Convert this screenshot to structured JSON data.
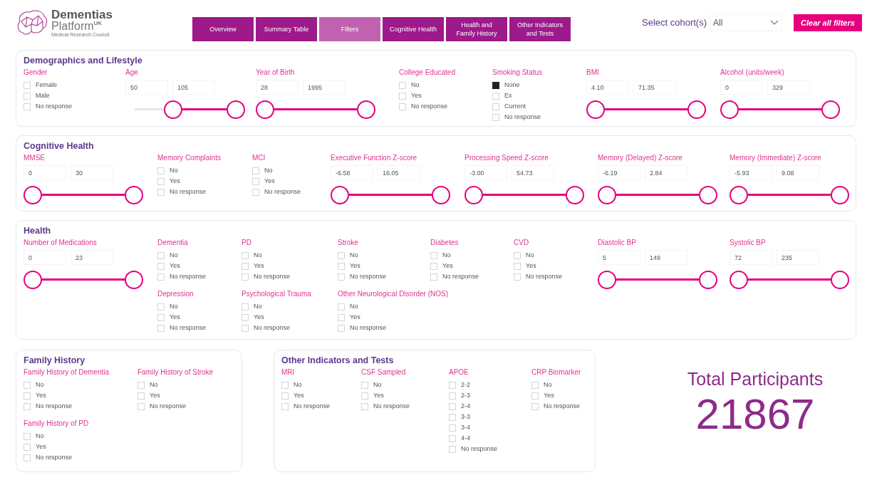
{
  "logo": {
    "name": "Dementias",
    "line2": "Platform",
    "superscript": "UK",
    "subtitle": "Medical Research Council"
  },
  "tabs": [
    {
      "label": "Overview",
      "selected": false
    },
    {
      "label": "Summary Table",
      "selected": false
    },
    {
      "label": "Filters",
      "selected": true
    },
    {
      "label": "Cognitive Health",
      "selected": false
    },
    {
      "label": "Health and Family History",
      "selected": false
    },
    {
      "label": "Other Indicators and Tests",
      "selected": false
    }
  ],
  "cohort": {
    "label": "Select cohort(s)",
    "value": "All"
  },
  "clear_button": "Clear all filters",
  "panels": [
    {
      "title": "Demographics and Lifestyle",
      "filters": [
        {
          "kind": "checklist",
          "label": "Gender",
          "options": [
            {
              "label": "Female",
              "checked": false
            },
            {
              "label": "Male",
              "checked": false
            },
            {
              "label": "No response",
              "checked": false
            }
          ]
        },
        {
          "kind": "range",
          "label": "Age",
          "min": "50",
          "max": "105",
          "level": 0.62
        },
        {
          "kind": "range",
          "label": "Year of Birth",
          "min": "28",
          "max": "1995",
          "level": 1
        },
        {
          "kind": "checklist",
          "label": "College Educated",
          "options": [
            {
              "label": "No",
              "checked": false
            },
            {
              "label": "Yes",
              "checked": false
            },
            {
              "label": "No response",
              "checked": false
            }
          ]
        },
        {
          "kind": "checklist",
          "label": "Smoking Status",
          "options": [
            {
              "label": "None",
              "checked": true
            },
            {
              "label": "Ex",
              "checked": false
            },
            {
              "label": "Current",
              "checked": false
            },
            {
              "label": "No response",
              "checked": false
            }
          ]
        },
        {
          "kind": "range",
          "label": "BMI",
          "min": "4.10",
          "max": "71.35",
          "level": 1
        },
        {
          "kind": "range",
          "label": "Alcohol (units/week)",
          "min": "0",
          "max": "329",
          "level": 1
        }
      ]
    },
    {
      "title": "Cognitive Health",
      "filters": [
        {
          "kind": "range",
          "label": "MMSE",
          "min": "0",
          "max": "30",
          "level": 1
        },
        {
          "kind": "checklist",
          "label": "Memory Complaints",
          "options": [
            {
              "label": "No",
              "checked": false
            },
            {
              "label": "Yes",
              "checked": false
            },
            {
              "label": "No response",
              "checked": false
            }
          ]
        },
        {
          "kind": "checklist",
          "label": "MCI",
          "options": [
            {
              "label": "No",
              "checked": false
            },
            {
              "label": "Yes",
              "checked": false
            },
            {
              "label": "No response",
              "checked": false
            }
          ]
        },
        {
          "kind": "range",
          "label": "Executive Function Z-score",
          "min": "-6.58",
          "max": "16.05",
          "level": 1
        },
        {
          "kind": "range",
          "label": "Processing Speed Z-score",
          "min": "-3.00",
          "max": "54.73",
          "level": 1
        },
        {
          "kind": "range",
          "label": "Memory (Delayed) Z-score",
          "min": "-6.19",
          "max": "2.84",
          "level": 1
        },
        {
          "kind": "range",
          "label": "Memory (Immediate) Z-score",
          "min": "-5.93",
          "max": "9.08",
          "level": 1
        }
      ]
    },
    {
      "title": "Health",
      "filters": [
        {
          "kind": "range",
          "label": "Number of Medications",
          "min": "0",
          "max": "23",
          "level": 1
        },
        {
          "kind": "checklist",
          "label": "Dementia",
          "options": [
            {
              "label": "No",
              "checked": false
            },
            {
              "label": "Yes",
              "checked": false
            },
            {
              "label": "No response",
              "checked": false
            }
          ]
        },
        {
          "kind": "checklist",
          "label": "PD",
          "options": [
            {
              "label": "No",
              "checked": false
            },
            {
              "label": "Yes",
              "checked": false
            },
            {
              "label": "No response",
              "checked": false
            }
          ]
        },
        {
          "kind": "checklist",
          "label": "Stroke",
          "options": [
            {
              "label": "No",
              "checked": false
            },
            {
              "label": "Yes",
              "checked": false
            },
            {
              "label": "No response",
              "checked": false
            }
          ]
        },
        {
          "kind": "checklist",
          "label": "Diabetes",
          "options": [
            {
              "label": "No",
              "checked": false
            },
            {
              "label": "Yes",
              "checked": false
            },
            {
              "label": "No response",
              "checked": false
            }
          ]
        },
        {
          "kind": "checklist",
          "label": "CVD",
          "options": [
            {
              "label": "No",
              "checked": false
            },
            {
              "label": "Yes",
              "checked": false
            },
            {
              "label": "No response",
              "checked": false
            }
          ]
        },
        {
          "kind": "range",
          "label": "Diastolic BP",
          "min": "5",
          "max": "149",
          "level": 1
        },
        {
          "kind": "range",
          "label": "Systolic BP",
          "min": "72",
          "max": "235",
          "level": 1
        },
        {
          "kind": "checklist",
          "label": "Depression",
          "options": [
            {
              "label": "No",
              "checked": false
            },
            {
              "label": "Yes",
              "checked": false
            },
            {
              "label": "No response",
              "checked": false
            }
          ]
        },
        {
          "kind": "checklist",
          "label": "Psychological Trauma",
          "options": [
            {
              "label": "No",
              "checked": false
            },
            {
              "label": "Yes",
              "checked": false
            },
            {
              "label": "No response",
              "checked": false
            }
          ]
        },
        {
          "kind": "checklist",
          "label": "Other Neurological Disorder (NOS)",
          "options": [
            {
              "label": "No",
              "checked": false
            },
            {
              "label": "Yes",
              "checked": false
            },
            {
              "label": "No response",
              "checked": false
            }
          ]
        }
      ]
    },
    {
      "title": "Family History",
      "filters": [
        {
          "kind": "checklist",
          "label": "Family History of Dementia",
          "options": [
            {
              "label": "No",
              "checked": false
            },
            {
              "label": "Yes",
              "checked": false
            },
            {
              "label": "No response",
              "checked": false
            }
          ]
        },
        {
          "kind": "checklist",
          "label": "Family History of Stroke",
          "options": [
            {
              "label": "No",
              "checked": false
            },
            {
              "label": "Yes",
              "checked": false
            },
            {
              "label": "No response",
              "checked": false
            }
          ]
        },
        {
          "kind": "checklist",
          "label": "Family History of PD",
          "options": [
            {
              "label": "No",
              "checked": false
            },
            {
              "label": "Yes",
              "checked": false
            },
            {
              "label": "No response",
              "checked": false
            }
          ]
        }
      ]
    },
    {
      "title": "Other Indicators and Tests",
      "filters": [
        {
          "kind": "checklist",
          "label": "MRI",
          "options": [
            {
              "label": "No",
              "checked": false
            },
            {
              "label": "Yes",
              "checked": false
            },
            {
              "label": "No response",
              "checked": false
            }
          ]
        },
        {
          "kind": "checklist",
          "label": "CSF Sampled",
          "options": [
            {
              "label": "No",
              "checked": false
            },
            {
              "label": "Yes",
              "checked": false
            },
            {
              "label": "No response",
              "checked": false
            }
          ]
        },
        {
          "kind": "checklist",
          "label": "APOE",
          "options": [
            {
              "label": "2-2",
              "checked": false
            },
            {
              "label": "2-3",
              "checked": false
            },
            {
              "label": "2-4",
              "checked": false
            },
            {
              "label": "3-3",
              "checked": false
            },
            {
              "label": "3-4",
              "checked": false
            },
            {
              "label": "4-4",
              "checked": false
            },
            {
              "label": "No response",
              "checked": false
            }
          ]
        },
        {
          "kind": "checklist",
          "label": "CRP Biomarker",
          "options": [
            {
              "label": "No",
              "checked": false
            },
            {
              "label": "Yes",
              "checked": false
            },
            {
              "label": "No response",
              "checked": false
            }
          ]
        }
      ]
    }
  ],
  "total": {
    "label": "Total Participants",
    "value": "21867"
  }
}
